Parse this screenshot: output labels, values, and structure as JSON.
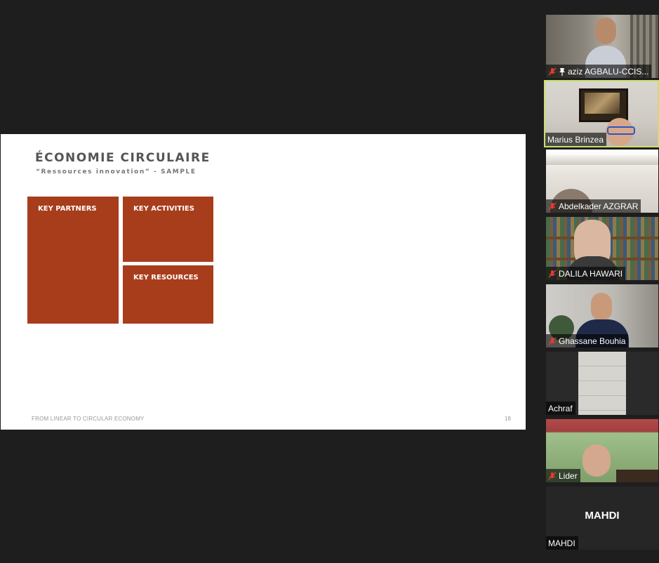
{
  "slide": {
    "title": "ÉCONOMIE CIRCULAIRE",
    "subtitle": "“Ressources innovation” - SAMPLE",
    "blocks": {
      "key_partners": "KEY PARTNERS",
      "key_activities": "KEY ACTIVITIES",
      "key_resources": "KEY RESOURCES"
    },
    "footer": "FROM LINEAR TO CIRCULAR ECONOMY",
    "page_number": "18"
  },
  "participants": [
    {
      "name": "aziz AGBALU-CCIS...",
      "muted": true,
      "pinned": true
    },
    {
      "name": "Marius Brinzea",
      "muted": false,
      "speaking": true
    },
    {
      "name": "Abdelkader AZGRAR",
      "muted": true
    },
    {
      "name": "DALILA HAWARI",
      "muted": true
    },
    {
      "name": "Ghassane Bouhia",
      "muted": true
    },
    {
      "name": "Achraf",
      "muted": false
    },
    {
      "name": "Lider",
      "muted": true
    },
    {
      "name": "MAHDI",
      "muted": false,
      "video_off": true,
      "center_label": "MAHDI"
    }
  ],
  "colors": {
    "background": "#1e1e1e",
    "block": "#a83d1c",
    "speaking_border": "#c9e06a",
    "mute_icon": "#e03c31"
  }
}
